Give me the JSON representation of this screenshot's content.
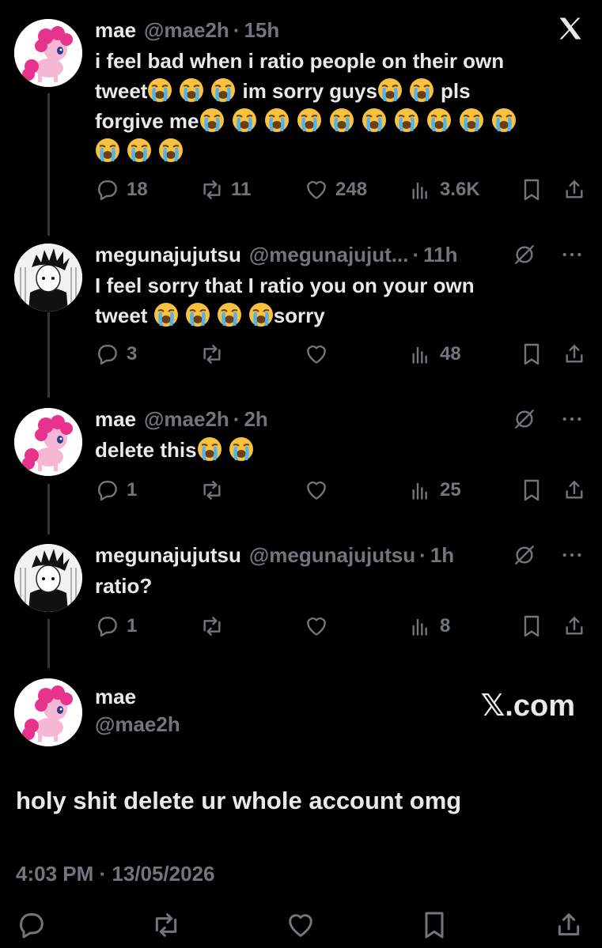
{
  "tweets": [
    {
      "name": "mae",
      "handle": "@mae2h",
      "sep": "·",
      "time": "15h",
      "text_lines": [
        "i feel bad when i ratio people on their own"
      ],
      "text_rich": {
        "line2_a": "tweet",
        "line2_b": "im sorry guys",
        "line2_c": "pls",
        "line3_a": "forgive me"
      },
      "replies": "18",
      "reposts": "11",
      "likes": "248",
      "views": "3.6K",
      "avatar": "pink-pony-avatar"
    },
    {
      "name": "megunajujutsu",
      "handle": "@megunajujut...",
      "sep": "·",
      "time": "11h",
      "line1": "I feel sorry that I ratio you on your own",
      "line2_a": "tweet",
      "line2_b": "sorry",
      "replies": "3",
      "reposts": "",
      "likes": "",
      "views": "48",
      "avatar": "anime-boy-avatar"
    },
    {
      "name": "mae",
      "handle": "@mae2h",
      "sep": "·",
      "time": "2h",
      "line1": "delete this",
      "replies": "1",
      "reposts": "",
      "likes": "",
      "views": "25",
      "avatar": "pink-pony-avatar"
    },
    {
      "name": "megunajujutsu",
      "handle": "@megunajujutsu",
      "sep": "·",
      "time": "1h",
      "line1": "ratio?",
      "replies": "1",
      "reposts": "",
      "likes": "",
      "views": "8",
      "avatar": "anime-boy-avatar"
    }
  ],
  "main": {
    "name": "mae",
    "handle": "@mae2h",
    "brand": "𝕏.com",
    "text": "holy shit delete ur whole account omg",
    "timestamp": "4:03 PM · 13/05/2026"
  },
  "colors": {
    "background": "#000000",
    "text": "#e7e9ea",
    "muted": "#71767b",
    "emoji_face": "#f9c23c"
  },
  "icons": [
    "x-logo-icon",
    "reply-icon",
    "repost-icon",
    "like-icon",
    "views-icon",
    "bookmark-icon",
    "share-icon",
    "grok-icon",
    "more-icon",
    "loudly-crying-face-emoji"
  ]
}
